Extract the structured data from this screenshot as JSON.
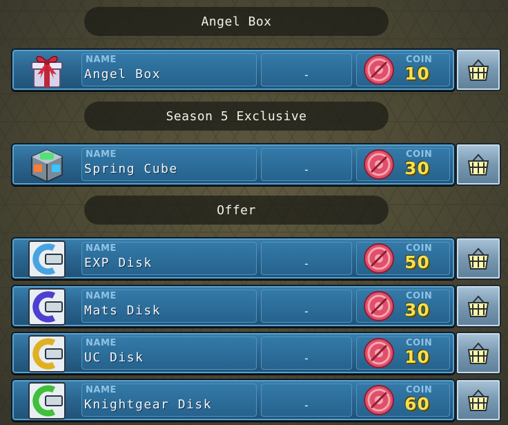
{
  "sections": [
    {
      "header": "Angel Box",
      "items": [
        {
          "caption": "NAME",
          "name": "Angel Box",
          "value": "-",
          "coin_caption": "COIN",
          "coin": "10",
          "icon": "gift-box-icon"
        }
      ]
    },
    {
      "header": "Season 5 Exclusive",
      "items": [
        {
          "caption": "NAME",
          "name": "Spring Cube",
          "value": "-",
          "coin_caption": "COIN",
          "coin": "30",
          "icon": "cube-icon"
        }
      ]
    },
    {
      "header": "Offer",
      "items": [
        {
          "caption": "NAME",
          "name": "EXP Disk",
          "value": "-",
          "coin_caption": "COIN",
          "coin": "50",
          "icon": "disk-icon",
          "disk_color": "#4aa3e0"
        },
        {
          "caption": "NAME",
          "name": "Mats Disk",
          "value": "-",
          "coin_caption": "COIN",
          "coin": "30",
          "icon": "disk-icon",
          "disk_color": "#4d3fd0"
        },
        {
          "caption": "NAME",
          "name": "UC Disk",
          "value": "-",
          "coin_caption": "COIN",
          "coin": "10",
          "icon": "disk-icon",
          "disk_color": "#e0b020"
        },
        {
          "caption": "NAME",
          "name": "Knightgear Disk",
          "value": "-",
          "coin_caption": "COIN",
          "coin": "60",
          "icon": "disk-icon",
          "disk_color": "#3fbf3a"
        }
      ]
    }
  ],
  "colors": {
    "panel": "#2b6691",
    "coin_text": "#f7e04a",
    "coin_token": "#e0506a",
    "button": "#7898b0"
  }
}
